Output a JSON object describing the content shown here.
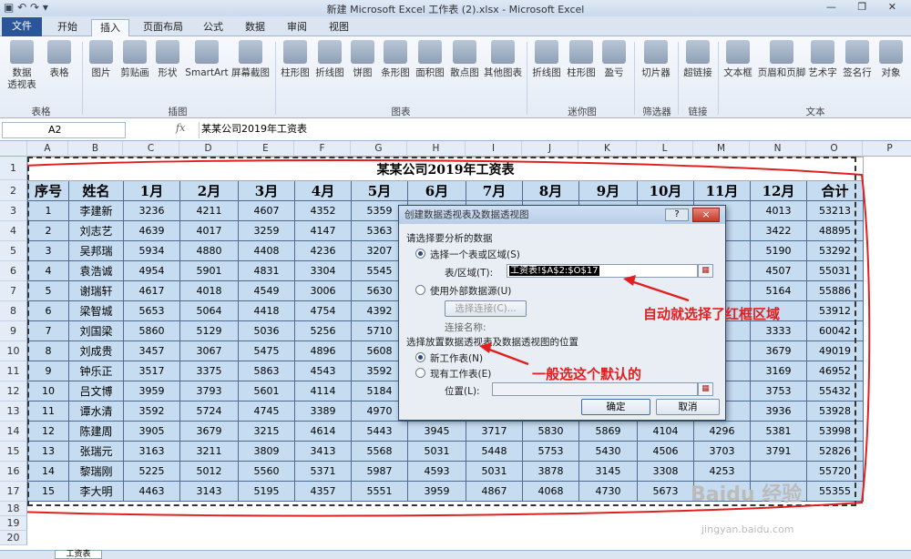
{
  "window": {
    "title": "新建 Microsoft Excel 工作表 (2).xlsx - Microsoft Excel"
  },
  "tabs": [
    "文件",
    "开始",
    "插入",
    "页面布局",
    "公式",
    "数据",
    "审阅",
    "视图"
  ],
  "ribbon": {
    "buttons": [
      "数据\n透视表",
      "表格",
      "图片",
      "剪贴画",
      "形状",
      "SmartArt",
      "屏幕截图",
      "柱形图",
      "折线图",
      "饼图",
      "条形图",
      "面积图",
      "散点图",
      "其他图表",
      "折线图",
      "柱形图",
      "盈亏",
      "切片器",
      "超链接",
      "文本框",
      "页眉和页脚",
      "艺术字",
      "签名行",
      "对象"
    ],
    "groups": [
      "表格",
      "插图",
      "图表",
      "迷你图",
      "筛选器",
      "链接",
      "文本"
    ]
  },
  "formula_bar": {
    "name_box": "A2",
    "fx": "fx",
    "formula": "某某公司2019年工资表"
  },
  "columns": [
    "A",
    "B",
    "C",
    "D",
    "E",
    "F",
    "G",
    "H",
    "I",
    "J",
    "K",
    "L",
    "M",
    "N",
    "O",
    "P"
  ],
  "rows": [
    "1",
    "2",
    "3",
    "4",
    "5",
    "6",
    "7",
    "8",
    "9",
    "10",
    "11",
    "12",
    "13",
    "14",
    "15",
    "16",
    "17",
    "18",
    "19",
    "20"
  ],
  "sheet": {
    "title": "某某公司2019年工资表",
    "headers": [
      "序号",
      "姓名",
      "1月",
      "2月",
      "3月",
      "4月",
      "5月",
      "6月",
      "7月",
      "8月",
      "9月",
      "10月",
      "11月",
      "12月",
      "合计"
    ],
    "rows": [
      [
        "1",
        "李建新",
        "3236",
        "4211",
        "4607",
        "4352",
        "5359",
        "",
        "",
        "",
        "",
        "",
        "",
        "4013",
        "53213"
      ],
      [
        "2",
        "刘志艺",
        "4639",
        "4017",
        "3259",
        "4147",
        "5363",
        "",
        "",
        "",
        "",
        "",
        "",
        "3422",
        "48895"
      ],
      [
        "3",
        "吴邦瑞",
        "5934",
        "4880",
        "4408",
        "4236",
        "3207",
        "",
        "",
        "",
        "",
        "",
        "",
        "5190",
        "53292"
      ],
      [
        "4",
        "袁浩诚",
        "4954",
        "5901",
        "4831",
        "3304",
        "5545",
        "",
        "",
        "",
        "",
        "",
        "",
        "4507",
        "55031"
      ],
      [
        "5",
        "谢瑞轩",
        "4617",
        "4018",
        "4549",
        "3006",
        "5630",
        "",
        "",
        "",
        "",
        "",
        "",
        "5164",
        "55886"
      ],
      [
        "6",
        "梁智城",
        "5653",
        "5064",
        "4418",
        "4754",
        "4392",
        "",
        "",
        "",
        "",
        "",
        "",
        "",
        "53912"
      ],
      [
        "7",
        "刘国梁",
        "5860",
        "5129",
        "5036",
        "5256",
        "5710",
        "",
        "",
        "",
        "",
        "",
        "",
        "3333",
        "60042"
      ],
      [
        "8",
        "刘成贵",
        "3457",
        "3067",
        "5475",
        "4896",
        "5608",
        "",
        "",
        "",
        "",
        "",
        "",
        "3679",
        "49019"
      ],
      [
        "9",
        "钟乐正",
        "3517",
        "3375",
        "5863",
        "4543",
        "3592",
        "",
        "",
        "",
        "",
        "",
        "",
        "3169",
        "46952"
      ],
      [
        "10",
        "吕文博",
        "3959",
        "3793",
        "5601",
        "4114",
        "5184",
        "",
        "",
        "",
        "",
        "",
        "",
        "3753",
        "55432"
      ],
      [
        "11",
        "谭水清",
        "3592",
        "5724",
        "4745",
        "3389",
        "4970",
        "",
        "",
        "",
        "",
        "",
        "",
        "3936",
        "53928"
      ],
      [
        "12",
        "陈建周",
        "3905",
        "3679",
        "3215",
        "4614",
        "5443",
        "3945",
        "3717",
        "5830",
        "5869",
        "4104",
        "4296",
        "5381",
        "53998"
      ],
      [
        "13",
        "张瑞元",
        "3163",
        "3211",
        "3809",
        "3413",
        "5568",
        "5031",
        "5448",
        "5753",
        "5430",
        "4506",
        "3703",
        "3791",
        "52826"
      ],
      [
        "14",
        "黎瑞刚",
        "5225",
        "5012",
        "5560",
        "5371",
        "5987",
        "4593",
        "5031",
        "3878",
        "3145",
        "3308",
        "4253",
        "",
        "55720"
      ],
      [
        "15",
        "李大明",
        "4463",
        "3143",
        "5195",
        "4357",
        "5551",
        "3959",
        "4867",
        "4068",
        "4730",
        "5673",
        "",
        "",
        "55355"
      ]
    ]
  },
  "dialog": {
    "title": "创建数据透视表及数据透视图",
    "help": "?",
    "close": "×",
    "section1": "请选择要分析的数据",
    "opt_range": "选择一个表或区域(S)",
    "range_label": "表/区域(T):",
    "range_value": "工资表!$A$2:$O$17",
    "opt_external": "使用外部数据源(U)",
    "choose_conn": "选择连接(C)...",
    "conn_name": "连接名称:",
    "section2": "选择放置数据透视表及数据透视图的位置",
    "opt_new": "新工作表(N)",
    "opt_existing": "现有工作表(E)",
    "location_label": "位置(L):",
    "ok": "确定",
    "cancel": "取消"
  },
  "annotations": {
    "auto_select": "自动就选择了红框区域",
    "default": "一般选这个默认的"
  },
  "sheet_tab": "工资表",
  "watermark": {
    "main": "Baidu 经验",
    "sub": "jingyan.baidu.com"
  },
  "colors": {
    "cell_fill": "#c6dcf0",
    "annotation": "#e02020",
    "file_tab": "#2a5699"
  }
}
